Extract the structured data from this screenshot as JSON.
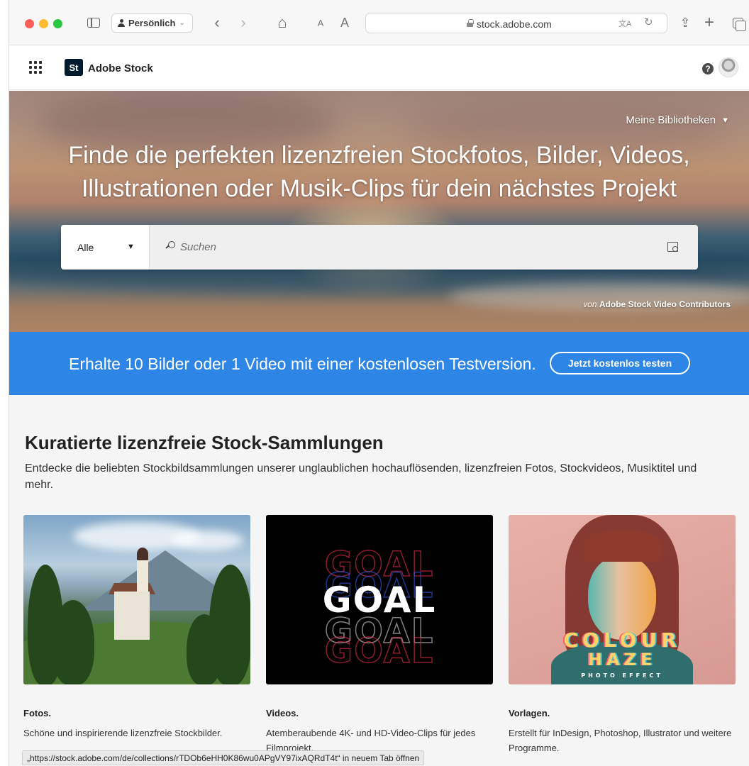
{
  "browser": {
    "profile_label": "Persönlich",
    "url": "stock.adobe.com",
    "font_small": "A",
    "font_large": "A"
  },
  "app_header": {
    "logo_text": "St",
    "brand_name": "Adobe Stock",
    "help_symbol": "?"
  },
  "hero": {
    "libraries_label": "Meine Bibliotheken",
    "headline_line1": "Finde die perfekten lizenzfreien Stockfotos, Bilder, Videos,",
    "headline_line2": "Illustrationen oder Musik-Clips für dein nächstes Projekt",
    "search": {
      "type_selected": "Alle",
      "placeholder": "Suchen"
    },
    "credit_prefix": "von",
    "credit_name": "Adobe Stock Video Contributors"
  },
  "banner": {
    "text": "Erhalte 10 Bilder oder 1 Video mit einer kostenlosen Testversion.",
    "button_label": "Jetzt kostenlos testen"
  },
  "collections": {
    "title": "Kuratierte lizenzfreie Stock-Sammlungen",
    "description": "Entdecke die beliebten Stockbildsammlungen unserer unglaublichen hochauflösenden, lizenzfreien Fotos, Stockvideos, Musiktitel und mehr.",
    "cards": [
      {
        "title": "Fotos.",
        "description": "Schöne und inspirierende lizenzfreie Stockbilder."
      },
      {
        "title": "Videos.",
        "description": "Atemberaubende 4K- und HD-Video-Clips für jedes Filmprojekt.",
        "thumb_text": "GOAL"
      },
      {
        "title": "Vorlagen.",
        "description": "Erstellt für InDesign, Photoshop, Illustrator und weitere Programme.",
        "thumb_text_1": "COLOUR",
        "thumb_text_2": "HAZE",
        "thumb_text_3": "PHOTO EFFECT"
      }
    ]
  },
  "status_bar": {
    "text": "„https://stock.adobe.com/de/collections/rTDOb6eHH0K86wu0APgVY97ixAQRdT4t“ in neuem Tab öffnen"
  },
  "colors": {
    "banner_blue": "#2d86e5",
    "logo_navy": "#001b2d",
    "traffic_red": "#fe5f57",
    "traffic_yellow": "#febc2e",
    "traffic_green": "#28c840"
  }
}
